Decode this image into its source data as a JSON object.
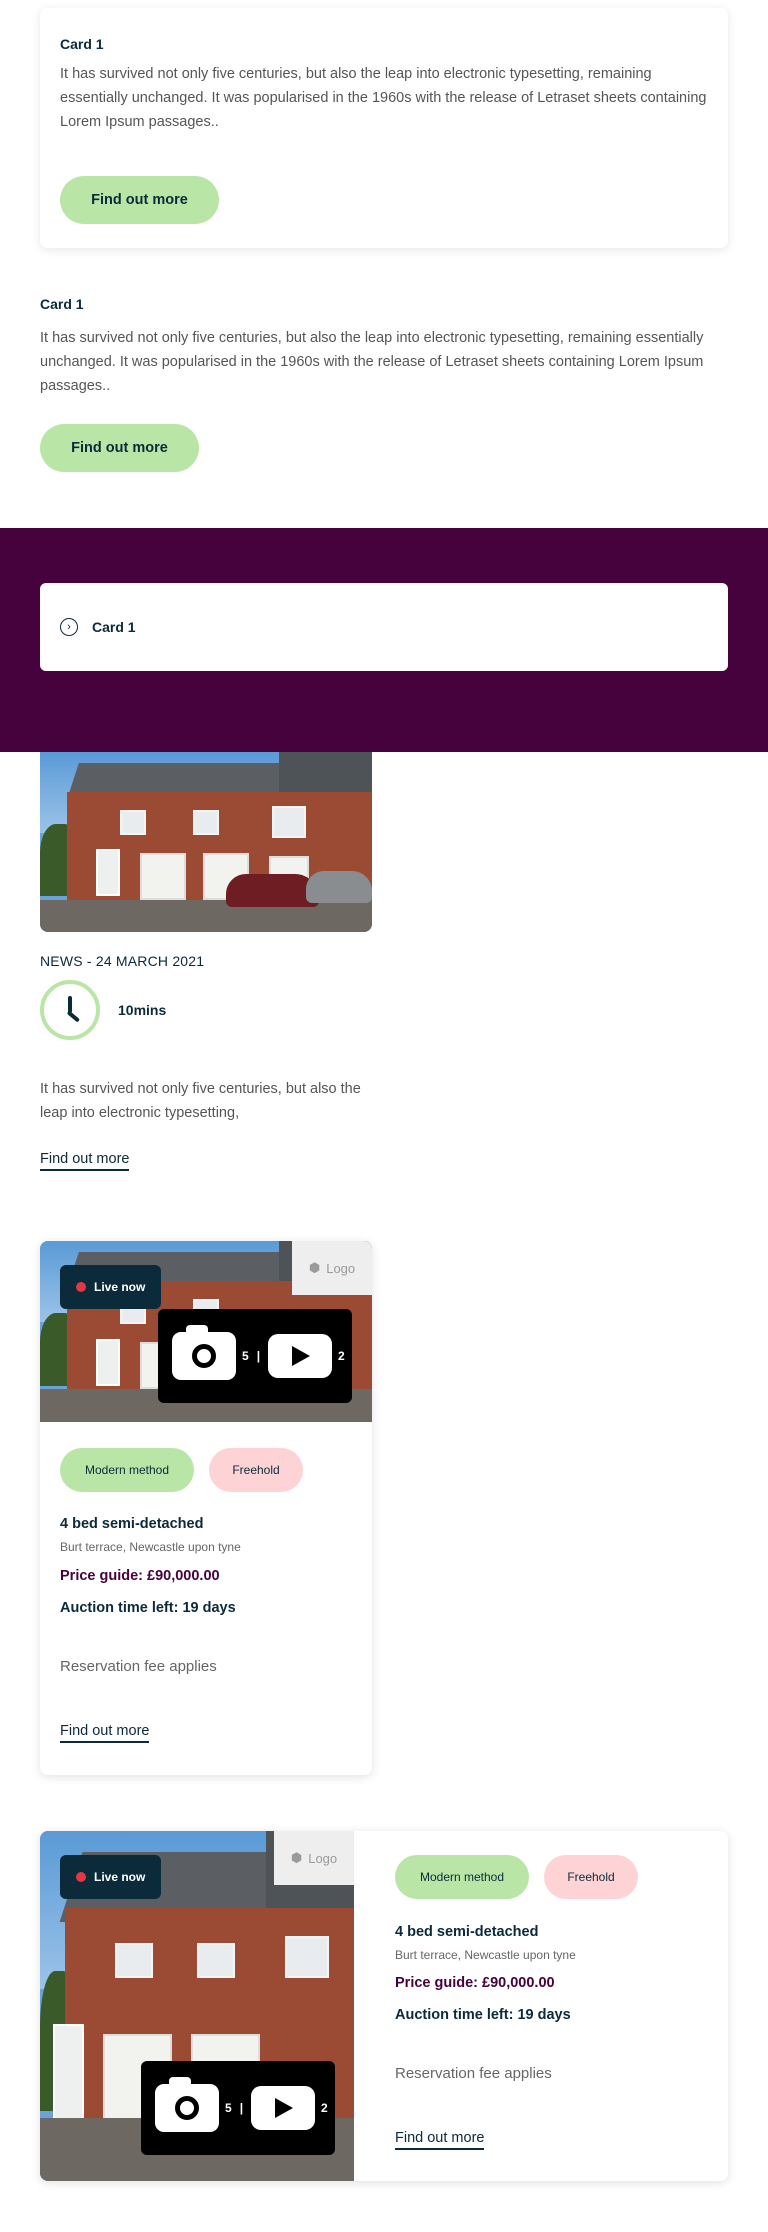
{
  "card1": {
    "title": "Card 1",
    "body": "It has survived not only five centuries, but also the leap into electronic typesetting, remaining essentially unchanged. It was popularised in the 1960s with the release of Letraset sheets containing Lorem Ipsum passages..",
    "button": "Find out more"
  },
  "card2": {
    "title": "Card 1",
    "body": "It has survived not only five centuries, but also the leap into electronic typesetting, remaining essentially unchanged. It was popularised in the 1960s with the release of Letraset sheets containing Lorem Ipsum passages..",
    "button": "Find out more"
  },
  "band_card": {
    "icon": "chevron-circle-icon",
    "title": "Card 1"
  },
  "news": {
    "meta": "NEWS - 24 MARCH 2021",
    "read_time": "10mins",
    "body": "It has survived not only five centuries, but also the leap into electronic typesetting,",
    "link": "Find out more"
  },
  "property1": {
    "live": "Live now",
    "logo": "Logo",
    "photo_count": "5",
    "divider": "|",
    "video_count": "2",
    "tags": [
      "Modern method",
      "Freehold"
    ],
    "title": "4 bed semi-detached",
    "address": "Burt terrace, Newcastle upon tyne",
    "price": "Price guide: £90,000.00",
    "time_left": "Auction time left: 19 days",
    "fee": "Reservation fee applies",
    "link": "Find out more"
  },
  "property2": {
    "live": "Live now",
    "logo": "Logo",
    "photo_count": "5",
    "divider": "|",
    "video_count": "2",
    "tags": [
      "Modern method",
      "Freehold"
    ],
    "title": "4 bed semi-detached",
    "address": "Burt terrace, Newcastle upon tyne",
    "price": "Price guide: £90,000.00",
    "time_left": "Auction time left: 19 days",
    "fee": "Reservation fee applies",
    "link": "Find out more"
  },
  "colors": {
    "accent_green": "#b9e6a6",
    "band_purple": "#45023d",
    "navy": "#0b2a3a",
    "pink_tag": "#fdd3d5",
    "live_dot": "#e33844"
  }
}
